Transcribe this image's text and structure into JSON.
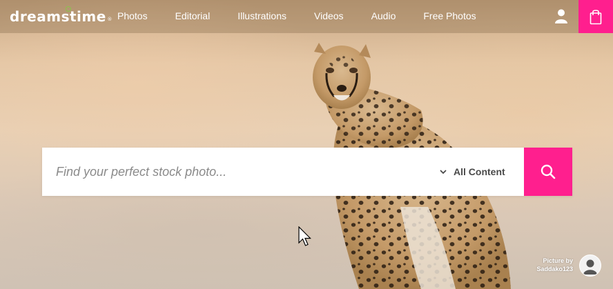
{
  "header": {
    "logo_text": "dreamstime",
    "logo_reg": "®",
    "nav": [
      {
        "label": "Photos"
      },
      {
        "label": "Editorial"
      },
      {
        "label": "Illustrations"
      },
      {
        "label": "Videos"
      },
      {
        "label": "Audio"
      },
      {
        "label": "Free Photos"
      }
    ],
    "user_icon": "user-icon",
    "cart_icon": "shopping-bag-icon"
  },
  "search": {
    "placeholder": "Find your perfect stock photo...",
    "value": "",
    "content_type": "All Content",
    "dropdown_icon": "chevron-down-icon",
    "button_icon": "search-icon"
  },
  "credit": {
    "line1": "Picture by",
    "author": "Saddako123"
  },
  "colors": {
    "accent": "#ff1f8e",
    "logo_dot": "#8bc34a"
  }
}
